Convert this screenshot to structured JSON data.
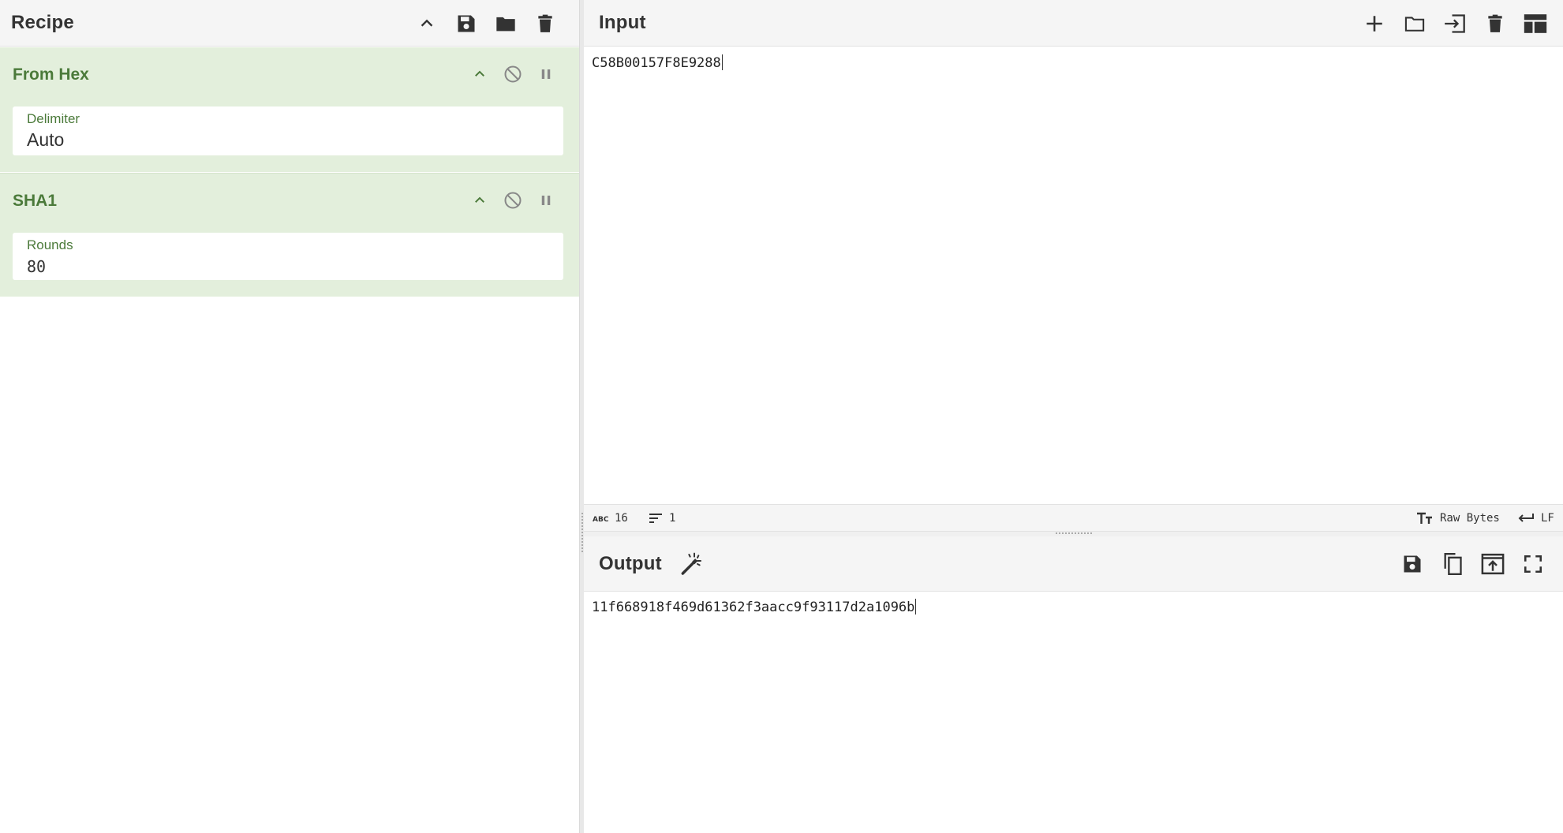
{
  "recipe": {
    "title": "Recipe",
    "tools": [
      "chevron-up-icon",
      "save-icon",
      "folder-icon",
      "trash-icon"
    ],
    "operations": [
      {
        "name": "From Hex",
        "arg_label": "Delimiter",
        "arg_value": "Auto"
      },
      {
        "name": "SHA1",
        "arg_label": "Rounds",
        "arg_value": "80"
      }
    ]
  },
  "input": {
    "title": "Input",
    "tools": [
      "plus-icon",
      "folder-open-icon",
      "sign-in-icon",
      "trash-icon",
      "layout-icon"
    ],
    "text": "C58B00157F8E9288",
    "status": {
      "length": "16",
      "lines": "1",
      "encoding": "Raw Bytes",
      "eol": "LF"
    }
  },
  "output": {
    "title": "Output",
    "tools": [
      "save-icon",
      "copy-icon",
      "replace-input-icon",
      "fullscreen-icon"
    ],
    "text": "11f668918f469d61362f3aacc9f93117d2a1096b"
  },
  "colors": {
    "op_background": "#e3efdc",
    "op_title": "#4b7a3a",
    "header_background": "#f5f5f5"
  }
}
